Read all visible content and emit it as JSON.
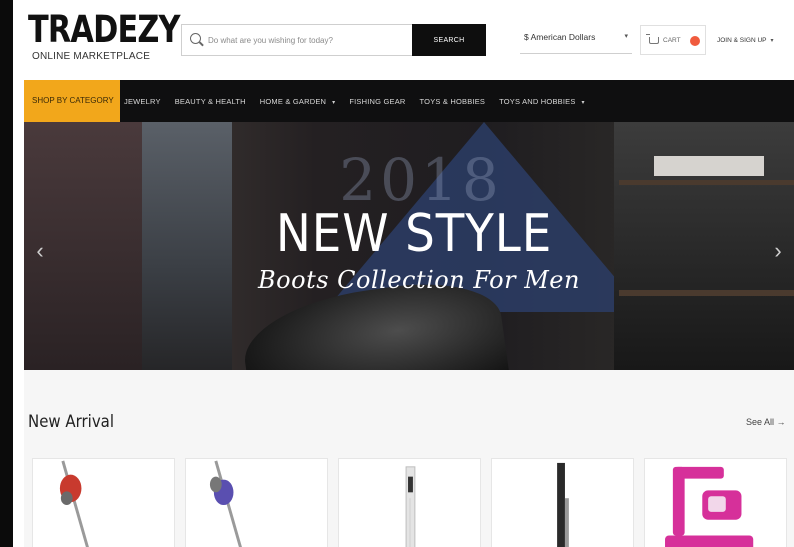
{
  "header": {
    "logo": {
      "name": "TRADEZY",
      "tagline": "ONLINE MARKETPLACE"
    },
    "search": {
      "placeholder": "Do what are you wishing for today?",
      "button_label": "SEARCH"
    },
    "currency": {
      "selected": "$ American Dollars"
    },
    "cart": {
      "label": "CART"
    },
    "account": {
      "label": "JOIN & SIGN UP"
    }
  },
  "nav": {
    "category_label": "SHOP BY CATEGORY",
    "items": [
      {
        "label": "JEWELRY",
        "has_dropdown": false
      },
      {
        "label": "BEAUTY & HEALTH",
        "has_dropdown": false
      },
      {
        "label": "HOME & GARDEN",
        "has_dropdown": true
      },
      {
        "label": "FISHING GEAR",
        "has_dropdown": false
      },
      {
        "label": "TOYS & HOBBIES",
        "has_dropdown": false
      },
      {
        "label": "TOYS AND HOBBIES",
        "has_dropdown": true
      }
    ]
  },
  "hero": {
    "year": "2018",
    "title": "NEW STYLE",
    "subtitle": "Boots Collection For Men"
  },
  "new_arrival": {
    "title": "New Arrival",
    "see_all": "See All →",
    "products": [
      {
        "icon": "vacuum-red-icon",
        "color": "#c83a2e"
      },
      {
        "icon": "vacuum-purple-icon",
        "color": "#5a4fb0"
      },
      {
        "icon": "stick-vacuum-white-icon",
        "color": "#e4e4e4"
      },
      {
        "icon": "stick-vacuum-black-icon",
        "color": "#222222"
      },
      {
        "icon": "vacuum-pink-icon",
        "color": "#d6309a"
      }
    ]
  },
  "colors": {
    "accent": "#f2a71b",
    "nav_bg": "#0f0f10",
    "search_button": "#0e0e0e",
    "cart_badge": "#f05b3e"
  }
}
